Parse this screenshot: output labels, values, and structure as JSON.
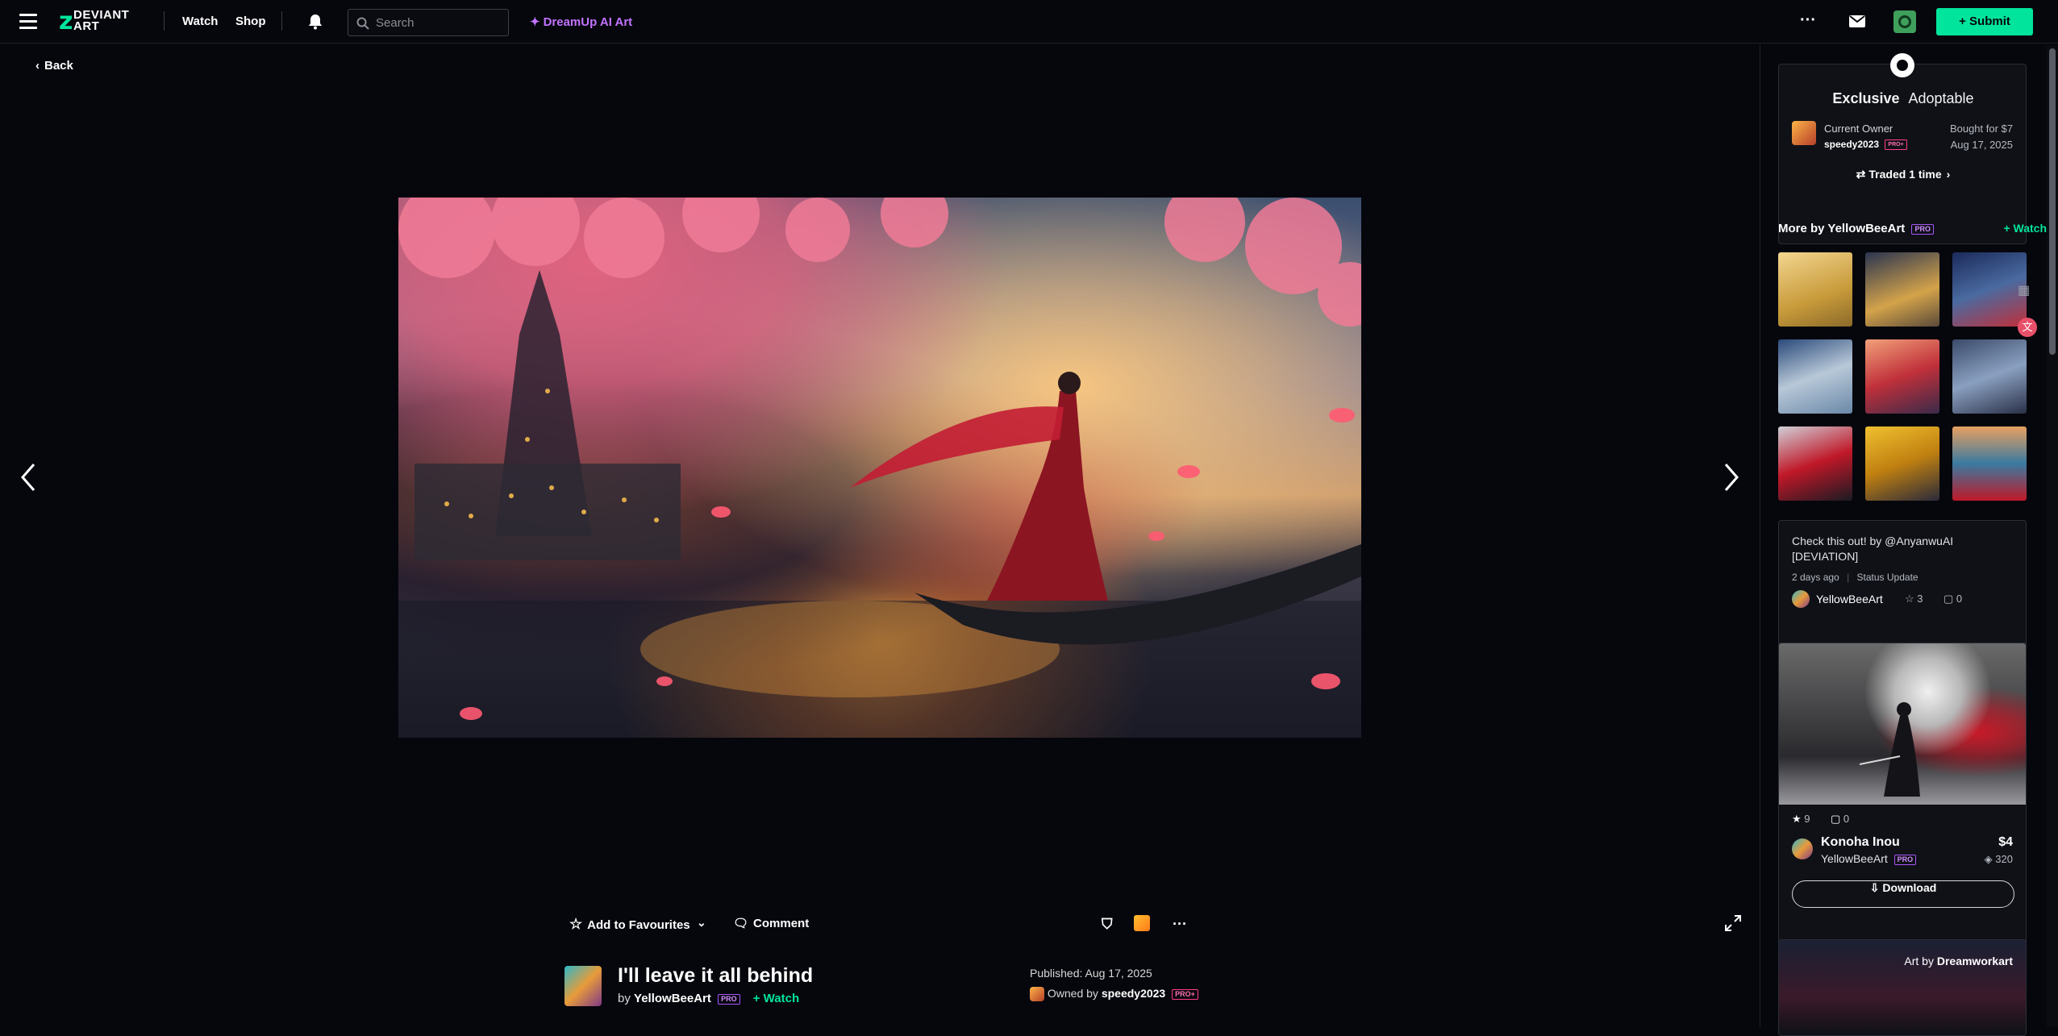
{
  "header": {
    "logo_text_1": "DEVIANT",
    "logo_text_2": "ART",
    "nav": [
      "Watch",
      "Shop"
    ],
    "search_placeholder": "Search",
    "dreamup": "DreamUp AI Art",
    "submit": "+ Submit",
    "more": "···"
  },
  "back": "Back",
  "actions": {
    "add_fav": "Add to Favourites",
    "comment": "Comment",
    "more": "···"
  },
  "deviation": {
    "title": "I'll leave it all behind",
    "by": "by",
    "author": "YellowBeeArt",
    "pro": "PRO",
    "watch": "+ Watch",
    "published": "Published: Aug 17, 2025",
    "owned_by": "Owned by",
    "owner": "speedy2023",
    "owner_badge": "PRO+"
  },
  "adoptable": {
    "exclusive": "Exclusive",
    "label": "Adoptable",
    "current_owner_label": "Current Owner",
    "owner": "speedy2023",
    "owner_badge": "PRO+",
    "bought": "Bought for $7",
    "date": "Aug 17, 2025",
    "traded": "Traded 1 time"
  },
  "more_by": {
    "title": "More by YellowBeeArt",
    "pro": "PRO",
    "watch": "+ Watch"
  },
  "status": {
    "text1": "Check this out! by @AnyanwuAI",
    "text2": "[DEVIATION]",
    "meta": "2 days ago",
    "type": "Status Update",
    "author": "YellowBeeArt",
    "favs": "3",
    "comments": "0"
  },
  "product": {
    "favs": "9",
    "comments": "0",
    "title": "Konoha Inou",
    "author": "YellowBeeArt",
    "pro": "PRO",
    "price": "$4",
    "points": "320",
    "download": "Download"
  },
  "next_card": {
    "art_by": "Art by",
    "author": "Dreamworkart"
  },
  "colors": {
    "accent": "#00e59b",
    "pro": "#a855f7",
    "dreamup": "#c273ff"
  }
}
